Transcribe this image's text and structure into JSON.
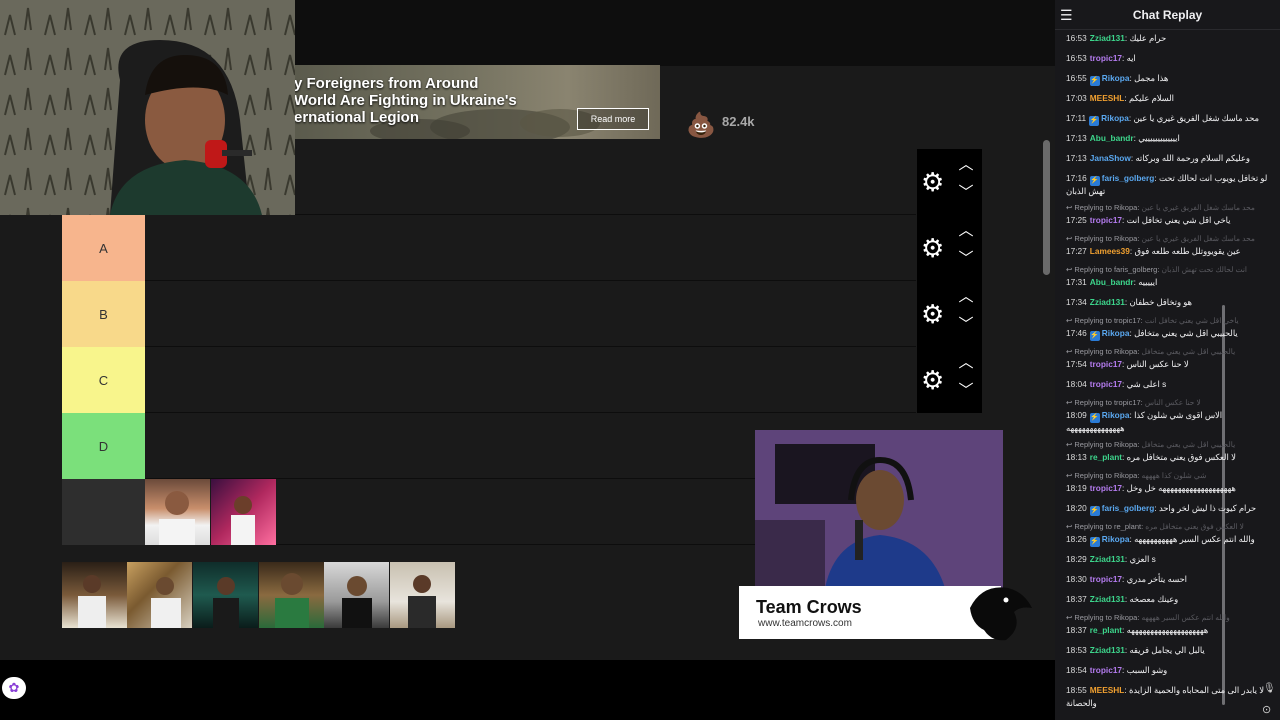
{
  "ad": {
    "lines": [
      "y Foreigners from Around",
      " World Are Fighting in Ukraine's",
      "ernational Legion"
    ],
    "button": "Read more"
  },
  "reaction": {
    "emoji": "💩",
    "count": "82.4k"
  },
  "tiers": [
    {
      "label": "A",
      "color": "#f7b58d"
    },
    {
      "label": "B",
      "color": "#f8d98a"
    },
    {
      "label": "C",
      "color": "#f8f58c"
    },
    {
      "label": "D",
      "color": "#7be07b"
    }
  ],
  "icons": {
    "gear": "gear-icon",
    "up": "chevron-up-icon",
    "down": "chevron-down-icon"
  },
  "crows": {
    "title": "Team Crows",
    "url": "www.teamcrows.com"
  },
  "chat": {
    "title": "Chat Replay",
    "messages": [
      {
        "t": "16:53",
        "u": "Zziad131",
        "c": "#3dd68c",
        "m": "حرام عليك"
      },
      {
        "t": "16:53",
        "u": "tropic17",
        "c": "#b57cf0",
        "m": "ايه"
      },
      {
        "t": "16:55",
        "u": "Rikopa",
        "c": "#5aa8f0",
        "m": "هذا مجمل",
        "b": true
      },
      {
        "t": "17:03",
        "u": "MEESHL",
        "c": "#f0a030",
        "m": "السلام عليكم"
      },
      {
        "t": "17:11",
        "u": "Rikopa",
        "c": "#5aa8f0",
        "m": "محد ماسك شغل الفريق غيري يا عين",
        "b": true
      },
      {
        "t": "17:13",
        "u": "Abu_bandr",
        "c": "#3dd68c",
        "m": "ايييييييييييييي"
      },
      {
        "t": "17:13",
        "u": "JanaShow",
        "c": "#5aa8f0",
        "m": "وعليكم السلام ورحمة الله وبركاته"
      },
      {
        "t": "17:16",
        "u": "faris_golberg",
        "c": "#5aa8f0",
        "m": "لو تخافل يويوب انت لحالك تحت",
        "m2": "تهش الذبان",
        "b": true
      },
      {
        "t": "17:25",
        "u": "tropic17",
        "c": "#b57cf0",
        "m": "ياخي اقل شي يعني تخافل انت",
        "r": "Replying to Rikopa:",
        "rq": "محد ماسك شغل الفريق غيري يا عين"
      },
      {
        "t": "17:27",
        "u": "Lamees39",
        "c": "#f0a030",
        "m": "عين يقويووتلل طلعه طلعه فوق",
        "r": "Replying to Rikopa:",
        "rq": "محد ماسك شغل الفريق غيري يا عين"
      },
      {
        "t": "17:31",
        "u": "Abu_bandr",
        "c": "#3dd68c",
        "m": "ايييييه",
        "r": "Replying to faris_golberg:",
        "rq": "انت لحالك تحت تهش الذبان"
      },
      {
        "t": "17:34",
        "u": "Zziad131",
        "c": "#3dd68c",
        "m": "هو وتخافل خطفان"
      },
      {
        "t": "17:46",
        "u": "Rikopa",
        "c": "#5aa8f0",
        "m": "يالحبيبي اقل شي يعني متخافل",
        "b": true,
        "r": "Replying to tropic17:",
        "rq": "ياخي اقل شي يعني تخافل انت"
      },
      {
        "t": "17:54",
        "u": "tropic17",
        "c": "#b57cf0",
        "m": "لا حنا عكس الناس",
        "r": "Replying to Rikopa:",
        "rq": "يالحبيبي اقل شي يعني متخافل"
      },
      {
        "t": "18:04",
        "u": "tropic17",
        "c": "#b57cf0",
        "m": "اعلى شي s"
      },
      {
        "t": "18:09",
        "u": "Rikopa",
        "c": "#5aa8f0",
        "m": "الاس اقوى شي شلون كذا",
        "m2": "ههههههههههههههه",
        "b": true,
        "r": "Replying to tropic17:",
        "rq": "لا حنا عكس الناس"
      },
      {
        "t": "18:13",
        "u": "re_plant",
        "c": "#3dd68c",
        "m": "لا العكس فوق يعني متخافل مره",
        "r": "Replying to Rikopa:",
        "rq": "يالحبيبي اقل شي يعني متخافل"
      },
      {
        "t": "18:19",
        "u": "tropic17",
        "c": "#b57cf0",
        "m": "هههههههههههههههههههه خل وخل",
        "r": "Replying to Rikopa:",
        "rq": "شي شلون كذا ههههه"
      },
      {
        "t": "18:20",
        "u": "faris_golberg",
        "c": "#5aa8f0",
        "m": "حرام كيوت ذا ليش لخر واحد",
        "b": true
      },
      {
        "t": "18:26",
        "u": "Rikopa",
        "c": "#5aa8f0",
        "m": "والله انتم عكس السير ههههههههههه",
        "b": true,
        "r": "Replying to re_plant:",
        "rq": "لا العكس فوق يعني متخافل مره"
      },
      {
        "t": "18:29",
        "u": "Zziad131",
        "c": "#3dd68c",
        "m": "العزي s"
      },
      {
        "t": "18:30",
        "u": "tropic17",
        "c": "#b57cf0",
        "m": "احسه يتأخر مدري"
      },
      {
        "t": "18:37",
        "u": "Zziad131",
        "c": "#3dd68c",
        "m": "وعينك معصخه"
      },
      {
        "t": "18:37",
        "u": "re_plant",
        "c": "#3dd68c",
        "m": "ههههههههههههههههههههه",
        "r": "Replying to Rikopa:",
        "rq": "والله انتم عكس السير ههههه"
      },
      {
        "t": "18:53",
        "u": "Zziad131",
        "c": "#3dd68c",
        "m": "يالبل الي يجامل فريقه"
      },
      {
        "t": "18:54",
        "u": "tropic17",
        "c": "#b57cf0",
        "m": "وشو السبب"
      },
      {
        "t": "18:55",
        "u": "MEESHL",
        "c": "#f0a030",
        "m": "لا يابدر الى متى المحاباه والحمية الزايدة",
        "m2": "والحصانة"
      }
    ]
  }
}
